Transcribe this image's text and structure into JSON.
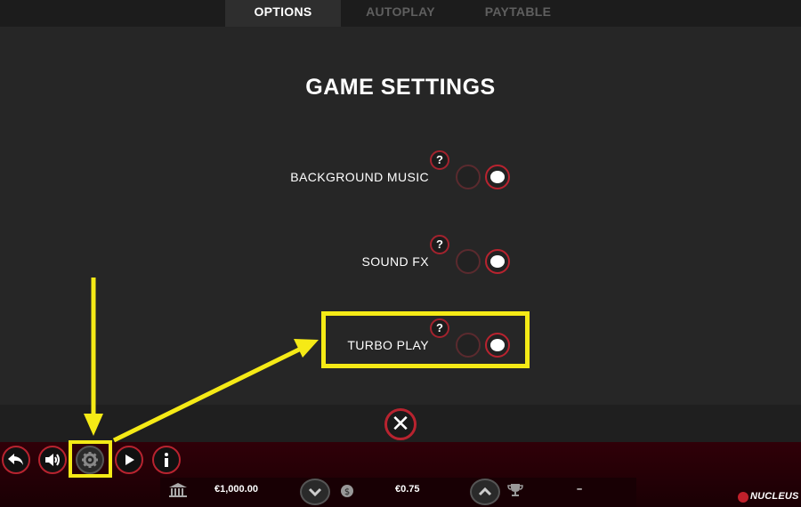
{
  "tabs": [
    {
      "label": "OPTIONS",
      "active": true
    },
    {
      "label": "AUTOPLAY",
      "active": false
    },
    {
      "label": "PAYTABLE",
      "active": false
    }
  ],
  "settings": {
    "title": "GAME SETTINGS",
    "rows": [
      {
        "label": "BACKGROUND MUSIC",
        "help": "?",
        "enabled": true
      },
      {
        "label": "SOUND FX",
        "help": "?",
        "enabled": true
      },
      {
        "label": "TURBO PLAY",
        "help": "?",
        "enabled": true
      }
    ]
  },
  "close": {
    "icon": "close-icon"
  },
  "controls": {
    "buttons": [
      "back-icon",
      "speaker-icon",
      "gear-icon",
      "play-icon",
      "info-icon"
    ],
    "balance": "€1,000.00",
    "bet": "€0.75",
    "win": "–",
    "brand": "NUCLEUS"
  },
  "colors": {
    "accent": "#b8232f",
    "annotation": "#f5ea16",
    "panel": "#262626"
  }
}
